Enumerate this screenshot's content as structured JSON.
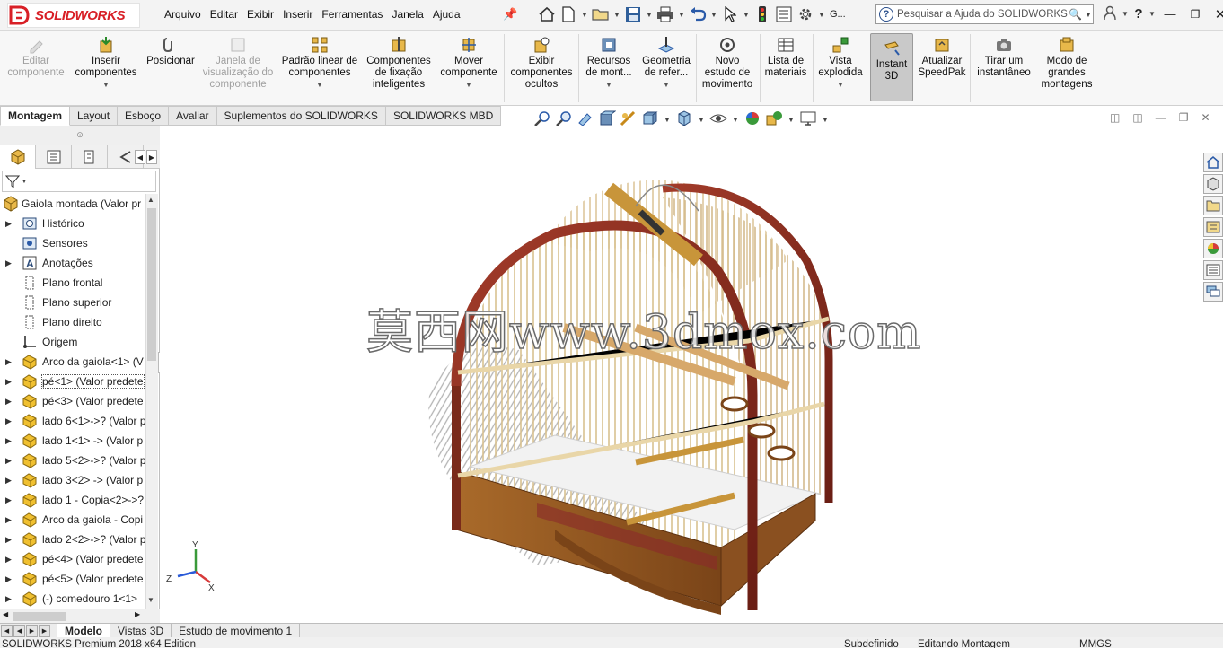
{
  "app": {
    "brand": "SOLIDWORKS",
    "accent": "#d81f26"
  },
  "menu": [
    "Arquivo",
    "Editar",
    "Exibir",
    "Inserir",
    "Ferramentas",
    "Janela",
    "Ajuda"
  ],
  "search": {
    "placeholder": "Pesquisar a Ajuda do SOLIDWORKS",
    "truncated_label": "G..."
  },
  "commands": [
    {
      "label": "Editar\ncomponente",
      "icon": "edit-component-icon",
      "disabled": true
    },
    {
      "label": "Inserir\ncomponentes",
      "icon": "insert-components-icon",
      "disabled": false
    },
    {
      "label": "Posicionar",
      "icon": "mate-icon",
      "disabled": false
    },
    {
      "label": "Janela de\nvisualização do\ncomponente",
      "icon": "component-preview-icon",
      "disabled": true
    },
    {
      "label": "Padrão linear de\ncomponentes",
      "icon": "linear-pattern-icon",
      "disabled": false
    },
    {
      "label": "Componentes\nde fixação\ninteligentes",
      "icon": "smart-fasteners-icon",
      "disabled": false
    },
    {
      "label": "Mover\ncomponente",
      "icon": "move-component-icon",
      "disabled": false
    },
    {
      "label": "Exibir\ncomponentes\nocultos",
      "icon": "show-hidden-icon",
      "disabled": false
    },
    {
      "label": "Recursos\nde mont...",
      "icon": "assembly-features-icon",
      "disabled": false
    },
    {
      "label": "Geometria\nde refer...",
      "icon": "reference-geometry-icon",
      "disabled": false
    },
    {
      "label": "Novo\nestudo de\nmovimento",
      "icon": "motion-study-icon",
      "disabled": false
    },
    {
      "label": "Lista de\nmateriais",
      "icon": "bom-icon",
      "disabled": false
    },
    {
      "label": "Vista\nexplodida",
      "icon": "exploded-view-icon",
      "disabled": false
    },
    {
      "label": "Instant\n3D",
      "icon": "instant3d-icon",
      "disabled": false
    },
    {
      "label": "Atualizar\nSpeedPak",
      "icon": "speedpak-icon",
      "disabled": false
    },
    {
      "label": "Tirar um\ninstantâneo",
      "icon": "snapshot-icon",
      "disabled": false
    },
    {
      "label": "Modo de\ngrandes\nmontagens",
      "icon": "large-assembly-icon",
      "disabled": false
    }
  ],
  "command_tabs": [
    "Montagem",
    "Layout",
    "Esboço",
    "Avaliar",
    "Suplementos do SOLIDWORKS",
    "SOLIDWORKS MBD"
  ],
  "tree": {
    "root": "Gaiola montada  (Valor pr",
    "items": [
      {
        "label": "Histórico",
        "icon": "history-icon",
        "expandable": true
      },
      {
        "label": "Sensores",
        "icon": "sensor-icon",
        "expandable": false
      },
      {
        "label": "Anotações",
        "icon": "annotation-icon",
        "expandable": true
      },
      {
        "label": "Plano frontal",
        "icon": "plane-icon",
        "expandable": false
      },
      {
        "label": "Plano superior",
        "icon": "plane-icon",
        "expandable": false
      },
      {
        "label": "Plano direito",
        "icon": "plane-icon",
        "expandable": false
      },
      {
        "label": "Origem",
        "icon": "origin-icon",
        "expandable": false
      },
      {
        "label": "Arco da gaiola<1> (V",
        "icon": "part-icon",
        "expandable": true
      },
      {
        "label": "pé<1> (Valor predete",
        "icon": "part-icon",
        "expandable": true,
        "selected": true
      },
      {
        "label": "pé<3> (Valor predete",
        "icon": "part-icon",
        "expandable": true
      },
      {
        "label": "lado 6<1>->? (Valor p",
        "icon": "part-icon",
        "expandable": true
      },
      {
        "label": "lado 1<1> -> (Valor p",
        "icon": "part-icon",
        "expandable": true
      },
      {
        "label": "lado 5<2>->? (Valor p",
        "icon": "part-icon",
        "expandable": true
      },
      {
        "label": "lado 3<2> -> (Valor p",
        "icon": "part-icon",
        "expandable": true
      },
      {
        "label": "lado 1 - Copia<2>->?",
        "icon": "part-icon",
        "expandable": true
      },
      {
        "label": "Arco da gaiola - Copi",
        "icon": "part-icon",
        "expandable": true
      },
      {
        "label": "lado 2<2>->? (Valor p",
        "icon": "part-icon",
        "expandable": true
      },
      {
        "label": "pé<4> (Valor predete",
        "icon": "part-icon",
        "expandable": true
      },
      {
        "label": "pé<5> (Valor predete",
        "icon": "part-icon",
        "expandable": true
      },
      {
        "label": "(-) comedouro 1<1>",
        "icon": "part-icon",
        "expandable": true
      }
    ]
  },
  "watermark": "莫西网www.3dmox.com",
  "triad": {
    "x": "X",
    "y": "Y",
    "z": "Z"
  },
  "bottom_tabs": [
    "Modelo",
    "Vistas 3D",
    "Estudo de movimento 1"
  ],
  "status": {
    "edition": "SOLIDWORKS Premium 2018 x64 Edition",
    "definition": "Subdefinido",
    "mode": "Editando Montagem",
    "units": "MMGS"
  }
}
